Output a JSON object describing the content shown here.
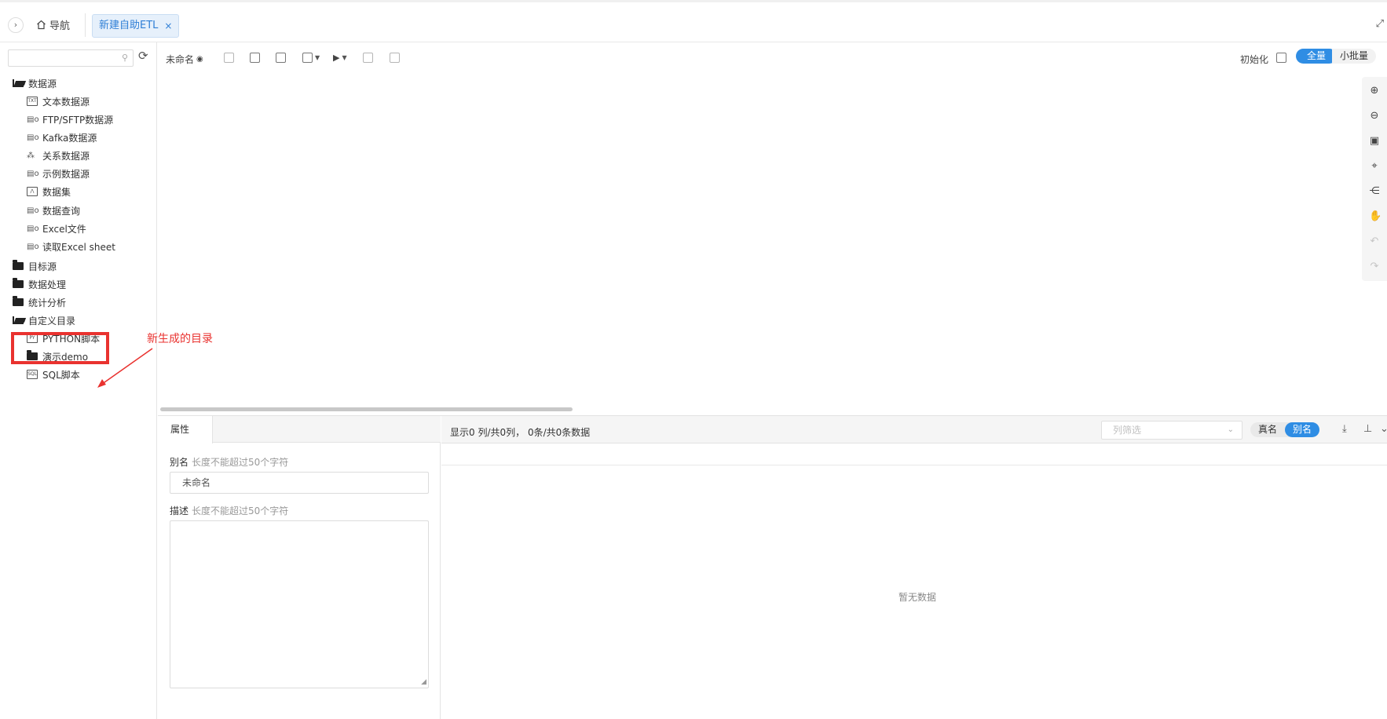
{
  "topbar": {
    "toggle_glyph": "›",
    "nav_label": "导航",
    "active_tab_label": "新建自助ETL",
    "active_tab_close": "×"
  },
  "sidebar": {
    "search_placeholder": "",
    "tree": [
      {
        "label": "数据源",
        "icon": "folder-open-icon"
      },
      {
        "label": "文本数据源",
        "icon": "text-file-icon"
      },
      {
        "label": "FTP/SFTP数据源",
        "icon": "datasource-icon"
      },
      {
        "label": "Kafka数据源",
        "icon": "datasource-icon"
      },
      {
        "label": "关系数据源",
        "icon": "relational-icon"
      },
      {
        "label": "示例数据源",
        "icon": "datasource-icon"
      },
      {
        "label": "数据集",
        "icon": "dataset-icon"
      },
      {
        "label": "数据查询",
        "icon": "datasource-icon"
      },
      {
        "label": "Excel文件",
        "icon": "datasource-icon"
      },
      {
        "label": "读取Excel sheet",
        "icon": "datasource-icon"
      },
      {
        "label": "目标源",
        "icon": "folder-icon"
      },
      {
        "label": "数据处理",
        "icon": "folder-icon"
      },
      {
        "label": "统计分析",
        "icon": "folder-icon"
      },
      {
        "label": "自定义目录",
        "icon": "folder-open-icon"
      },
      {
        "label": "PYTHON脚本",
        "icon": "python-script-icon"
      },
      {
        "label": "演示demo",
        "icon": "folder-icon"
      },
      {
        "label": "SQL脚本",
        "icon": "sql-script-icon"
      }
    ]
  },
  "annotation": {
    "text": "新生成的目录",
    "color": "#e9322f"
  },
  "toolbar": {
    "flow_name": "未命名",
    "init_label": "初始化",
    "mode_full": "全量",
    "mode_small": "小批量"
  },
  "properties": {
    "tab_label": "属性",
    "alias_label": "别名",
    "alias_hint": "长度不能超过50个字符",
    "alias_value": "未命名",
    "desc_label": "描述",
    "desc_hint": "长度不能超过50个字符"
  },
  "data_preview": {
    "info": "显示0 列/共0列， 0条/共0条数据",
    "filter_placeholder": "列筛选",
    "real_name_label": "真名",
    "alias_label": "别名",
    "empty_text": "暂无数据"
  },
  "colors": {
    "accent": "#2f8de4",
    "tab_bg": "#e6f0fb",
    "annotation": "#e9322f"
  }
}
